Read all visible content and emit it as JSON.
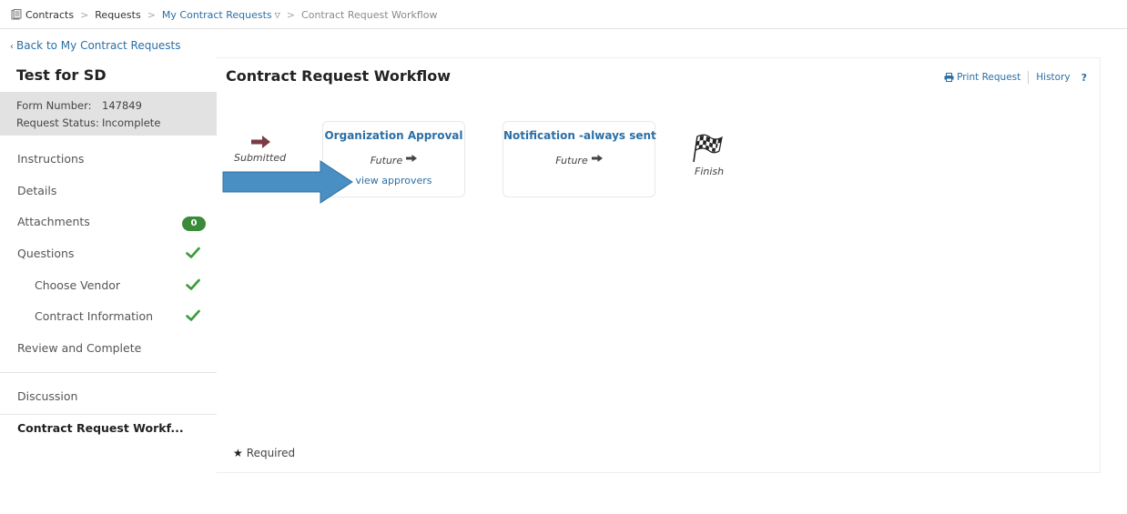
{
  "breadcrumb": {
    "items": [
      {
        "label": "Contracts",
        "kind": "plain"
      },
      {
        "label": "Requests",
        "kind": "plain"
      },
      {
        "label": "My Contract Requests",
        "kind": "link"
      },
      {
        "label": "Contract Request Workflow",
        "kind": "current"
      }
    ],
    "separator": ">"
  },
  "sidebar": {
    "back_label": "Back to My Contract Requests",
    "title": "Test for SD",
    "form_number_label": "Form Number:",
    "form_number": "147849",
    "status_label": "Request Status:",
    "status": "Incomplete",
    "items": [
      {
        "label": "Instructions"
      },
      {
        "label": "Details"
      },
      {
        "label": "Attachments",
        "badge": "0"
      },
      {
        "label": "Questions",
        "check": true
      },
      {
        "label": "Choose Vendor",
        "check": true
      },
      {
        "label": "Contract Information",
        "check": true
      },
      {
        "label": "Review and Complete"
      },
      {
        "label": "Discussion"
      },
      {
        "label": "Contract Request Workf..."
      }
    ]
  },
  "main": {
    "title": "Contract Request Workflow",
    "print_label": "Print Request",
    "history_label": "History",
    "help_label": "?",
    "workflow": {
      "start_label": "Submitted",
      "steps": [
        {
          "title": "Organization Approval",
          "status": "Future",
          "link": "view approvers"
        },
        {
          "title": "Notification -always sent",
          "status": "Future"
        }
      ],
      "finish_label": "Finish"
    },
    "required_label": "Required"
  },
  "colors": {
    "link": "#2a6fa6",
    "meta_bg": "#e2e2e2",
    "check": "#3a9a3a",
    "badge": "#3a8a3a",
    "callout_arrow": "#4a8fc4"
  }
}
